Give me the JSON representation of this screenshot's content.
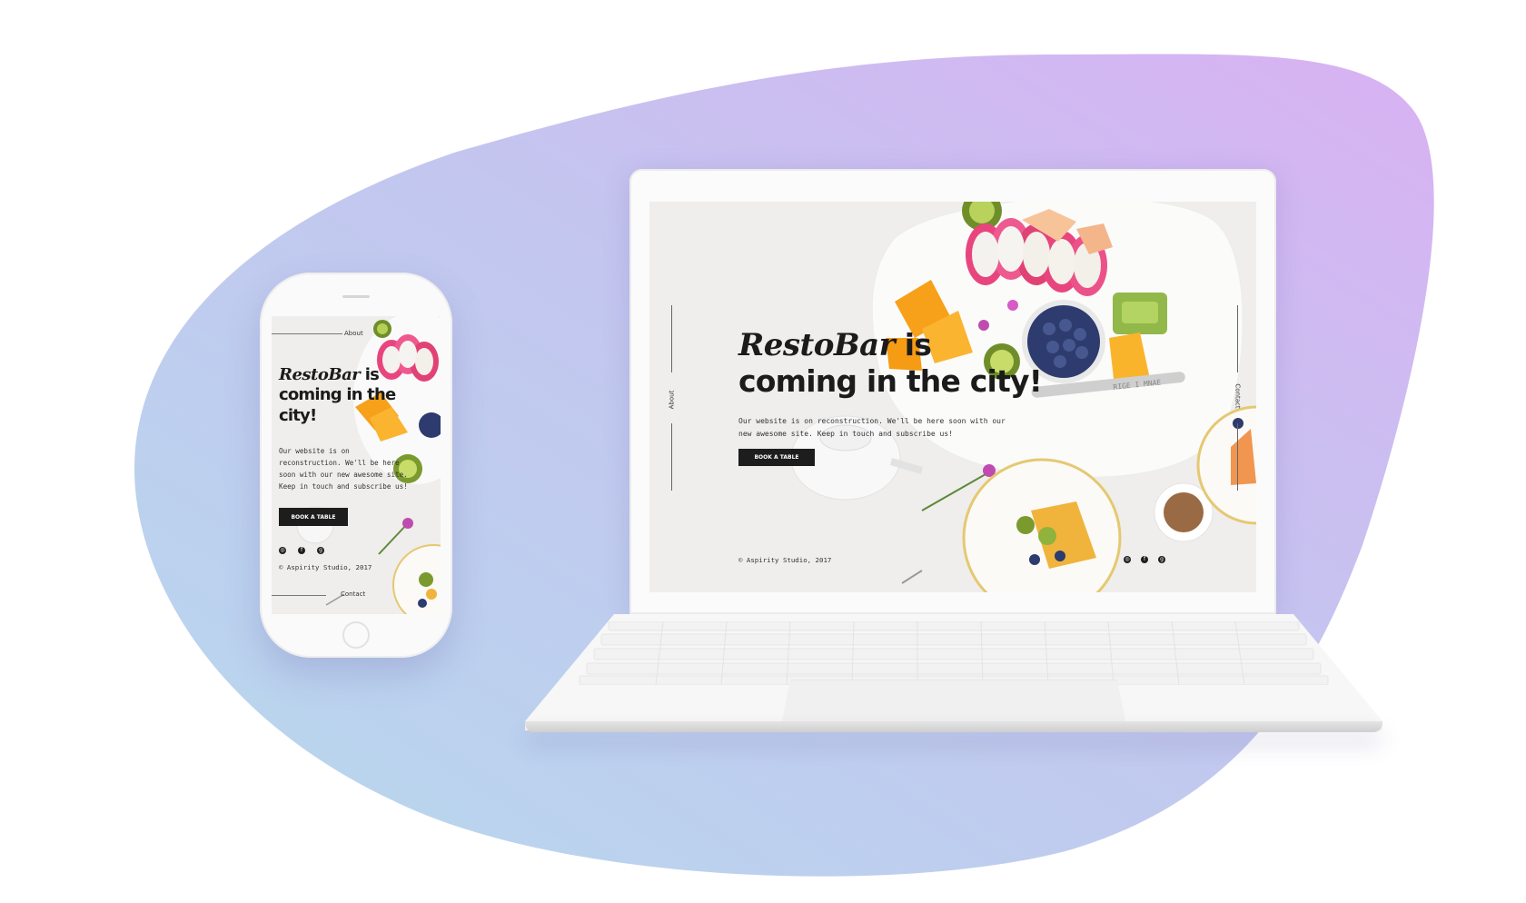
{
  "colors": {
    "blob_left": "#b9d8ef",
    "blob_mid": "#c6c6f0",
    "blob_right": "#d9b3f2",
    "button_bg": "#1d1d1d",
    "text_dark": "#1b1b1b",
    "screen_bg": "#efeeec"
  },
  "site": {
    "brand": "RestoBar",
    "brand_suffix": " is",
    "headline_line1": "coming in the",
    "headline_line2": "city!",
    "headline_rest": "coming in the city!",
    "description_desktop_line1": "Our website is on reconstruction. We'll be here soon with our",
    "description_desktop_line2": "new awesome site. Keep in touch and subscribe us!",
    "description_mobile": "Our website is on reconstruction. We'll be here soon with our new awesome site. Keep in touch and subscribe us!",
    "cta_label": "BOOK A TABLE",
    "copyright": "© Aspirity Studio, 2017",
    "nav_about": "About",
    "nav_contact": "Contact"
  },
  "social_icons": [
    {
      "name": "instagram-icon",
      "glyph": "◎"
    },
    {
      "name": "facebook-icon",
      "glyph": "f"
    },
    {
      "name": "google-plus-icon",
      "glyph": "g"
    }
  ]
}
